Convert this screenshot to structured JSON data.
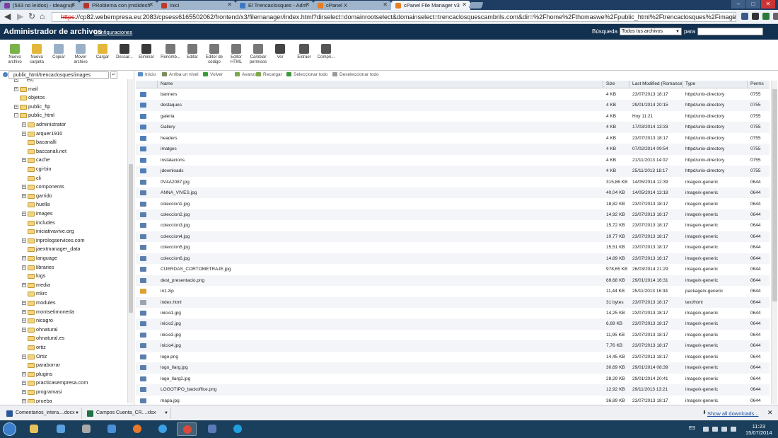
{
  "browser": {
    "tabs": [
      {
        "label": "(583 no leídos) - ideagrup",
        "color": "#7b3fa0"
      },
      {
        "label": "PRoblema con jmslidesh",
        "color": "#b5342e"
      },
      {
        "label": "Inici",
        "color": "#c0392b"
      },
      {
        "label": "El Trencaclosques - Adm",
        "color": "#3e78c2"
      },
      {
        "label": "cPanel X",
        "color": "#e67e22"
      },
      {
        "label": "cPanel File Manager v3",
        "color": "#e67e22"
      }
    ],
    "url_scheme": "https",
    "url_rest": "://cp82.webempresa.eu:2083/cpsess6165502062/frontend/x3/filemanager/index.html?dirselect=domainrootselect&domainselect=trencaclosquescambrils.com&dir=%2Fhome%2Fthomaswe%2Fpublic_html%2Ftrencaclosques%2Fimages"
  },
  "header": {
    "title": "Administrador de archivos",
    "config_link": "Configuraciones",
    "search_label": "Búsqueda",
    "search_scope": "Todos tus archivos",
    "search_for_label": "para",
    "search_value": ""
  },
  "toolbar": [
    {
      "label": "Nuevo archivo",
      "color": "#7ab34a"
    },
    {
      "label": "Nueva carpeta",
      "color": "#e3b83a"
    },
    {
      "label": "Copiar",
      "color": "#9ab0c8"
    },
    {
      "label": "Mover archivo",
      "color": "#9ab0c8"
    },
    {
      "label": "Cargar",
      "color": "#e3b83a"
    },
    {
      "label": "Descar...",
      "color": "#3a3a3a"
    },
    {
      "label": "Eliminar",
      "color": "#3a3a3a"
    },
    {
      "label": "Renomb...",
      "color": "#777777"
    },
    {
      "label": "Editar",
      "color": "#777777"
    },
    {
      "label": "Editor de código",
      "color": "#777777"
    },
    {
      "label": "Editor HTML",
      "color": "#777777"
    },
    {
      "label": "Cambiar permisos",
      "color": "#777777"
    },
    {
      "label": "Ver",
      "color": "#444444"
    },
    {
      "label": "Extraer",
      "color": "#555555"
    },
    {
      "label": "Compri...",
      "color": "#555555"
    }
  ],
  "left_panel": {
    "path": "public_html/trencaclosques/images",
    "tree": [
      {
        "label": "etc",
        "level": 1,
        "expander": "+",
        "folder": false
      },
      {
        "label": "mail",
        "level": 1,
        "expander": "+",
        "folder": true
      },
      {
        "label": "objetos",
        "level": 1,
        "expander": "",
        "folder": true
      },
      {
        "label": "public_ftp",
        "level": 1,
        "expander": "+",
        "folder": true
      },
      {
        "label": "public_html",
        "level": 1,
        "expander": "−",
        "folder": true
      },
      {
        "label": "administrator",
        "level": 2,
        "expander": "+",
        "folder": true
      },
      {
        "label": "arquer1910",
        "level": 2,
        "expander": "+",
        "folder": true
      },
      {
        "label": "bacanalli",
        "level": 2,
        "expander": "",
        "folder": true
      },
      {
        "label": "baccanali.net",
        "level": 2,
        "expander": "",
        "folder": true
      },
      {
        "label": "cache",
        "level": 2,
        "expander": "+",
        "folder": true
      },
      {
        "label": "cgi-bin",
        "level": 2,
        "expander": "",
        "folder": true
      },
      {
        "label": "cli",
        "level": 2,
        "expander": "",
        "folder": true
      },
      {
        "label": "components",
        "level": 2,
        "expander": "+",
        "folder": true
      },
      {
        "label": "garrido",
        "level": 2,
        "expander": "+",
        "folder": true
      },
      {
        "label": "huella",
        "level": 2,
        "expander": "",
        "folder": true
      },
      {
        "label": "images",
        "level": 2,
        "expander": "+",
        "folder": true
      },
      {
        "label": "includes",
        "level": 2,
        "expander": "",
        "folder": true
      },
      {
        "label": "iniciativavive.org",
        "level": 2,
        "expander": "",
        "folder": true
      },
      {
        "label": "inprologservices.com",
        "level": 2,
        "expander": "+",
        "folder": true
      },
      {
        "label": "jaextmanager_data",
        "level": 2,
        "expander": "",
        "folder": true
      },
      {
        "label": "language",
        "level": 2,
        "expander": "+",
        "folder": true
      },
      {
        "label": "libraries",
        "level": 2,
        "expander": "+",
        "folder": true
      },
      {
        "label": "logs",
        "level": 2,
        "expander": "",
        "folder": true
      },
      {
        "label": "media",
        "level": 2,
        "expander": "+",
        "folder": true
      },
      {
        "label": "mkrc",
        "level": 2,
        "expander": "",
        "folder": true
      },
      {
        "label": "modules",
        "level": 2,
        "expander": "+",
        "folder": true
      },
      {
        "label": "montsetimoneda",
        "level": 2,
        "expander": "+",
        "folder": true
      },
      {
        "label": "nicagro",
        "level": 2,
        "expander": "+",
        "folder": true
      },
      {
        "label": "ohnatural",
        "level": 2,
        "expander": "+",
        "folder": true
      },
      {
        "label": "ohnatural.es",
        "level": 2,
        "expander": "",
        "folder": true
      },
      {
        "label": "ortiz",
        "level": 2,
        "expander": "",
        "folder": true
      },
      {
        "label": "Ortiz",
        "level": 2,
        "expander": "+",
        "folder": true
      },
      {
        "label": "paraborrar",
        "level": 2,
        "expander": "",
        "folder": true
      },
      {
        "label": "plugins",
        "level": 2,
        "expander": "+",
        "folder": true
      },
      {
        "label": "practicasempresa.com",
        "level": 2,
        "expander": "+",
        "folder": true
      },
      {
        "label": "programasi",
        "level": 2,
        "expander": "+",
        "folder": true
      },
      {
        "label": "prueba",
        "level": 2,
        "expander": "+",
        "folder": true
      }
    ]
  },
  "actions": [
    {
      "label": "Inicio",
      "color": "#5b8dc9"
    },
    {
      "label": "Arriba un nivel",
      "color": "#7a8f5a"
    },
    {
      "label": "Volver",
      "color": "#3a9a3a"
    },
    {
      "label": "Avanzar",
      "color": "#7aa84a"
    },
    {
      "label": "Recargar",
      "color": "#7aa84a"
    },
    {
      "label": "Seleccionar todo",
      "color": "#3a9a3a"
    },
    {
      "label": "Deseleccionar todo",
      "color": "#9a9a9a"
    }
  ],
  "grid": {
    "columns": [
      "Name",
      "Size",
      "Last Modified (Romance",
      "Type",
      "Perms"
    ],
    "rows": [
      {
        "kind": "folder",
        "name": "banners",
        "size": "4 KB",
        "modified": "23/07/2013 18:17",
        "type": "httpd/unix-directory",
        "perms": "0755"
      },
      {
        "kind": "folder",
        "name": "destaques",
        "size": "4 KB",
        "modified": "29/01/2014 20:15",
        "type": "httpd/unix-directory",
        "perms": "0755"
      },
      {
        "kind": "folder",
        "name": "galeria",
        "size": "4 KB",
        "modified": "Hoy 11:21",
        "type": "httpd/unix-directory",
        "perms": "0755"
      },
      {
        "kind": "folder",
        "name": "Gallery",
        "size": "4 KB",
        "modified": "17/03/2014 13:33",
        "type": "httpd/unix-directory",
        "perms": "0755"
      },
      {
        "kind": "folder",
        "name": "headers",
        "size": "4 KB",
        "modified": "23/07/2013 18:17",
        "type": "httpd/unix-directory",
        "perms": "0755"
      },
      {
        "kind": "folder",
        "name": "imatges",
        "size": "4 KB",
        "modified": "07/02/2014 09:54",
        "type": "httpd/unix-directory",
        "perms": "0755"
      },
      {
        "kind": "folder",
        "name": "instalacions",
        "size": "4 KB",
        "modified": "21/11/2013 14:02",
        "type": "httpd/unix-directory",
        "perms": "0755"
      },
      {
        "kind": "folder",
        "name": "jdownloads",
        "size": "4 KB",
        "modified": "25/11/2013 18:17",
        "type": "httpd/unix-directory",
        "perms": "0755"
      },
      {
        "kind": "image",
        "name": "0V4A2087.jpg",
        "size": "315,86 KB",
        "modified": "14/05/2014 12:39",
        "type": "image/x-generic",
        "perms": "0644"
      },
      {
        "kind": "image",
        "name": "ANNA_VIVES.jpg",
        "size": "40,04 KB",
        "modified": "14/05/2014 13:18",
        "type": "image/x-generic",
        "perms": "0644"
      },
      {
        "kind": "image",
        "name": "coleccion1.jpg",
        "size": "18,82 KB",
        "modified": "23/07/2013 18:17",
        "type": "image/x-generic",
        "perms": "0644"
      },
      {
        "kind": "image",
        "name": "coleccion2.jpg",
        "size": "14,92 KB",
        "modified": "23/07/2013 18:17",
        "type": "image/x-generic",
        "perms": "0644"
      },
      {
        "kind": "image",
        "name": "coleccion3.jpg",
        "size": "15,72 KB",
        "modified": "23/07/2013 18:17",
        "type": "image/x-generic",
        "perms": "0644"
      },
      {
        "kind": "image",
        "name": "coleccion4.jpg",
        "size": "10,77 KB",
        "modified": "23/07/2013 18:17",
        "type": "image/x-generic",
        "perms": "0644"
      },
      {
        "kind": "image",
        "name": "coleccion5.jpg",
        "size": "15,51 KB",
        "modified": "23/07/2013 18:17",
        "type": "image/x-generic",
        "perms": "0644"
      },
      {
        "kind": "image",
        "name": "coleccion6.jpg",
        "size": "14,89 KB",
        "modified": "23/07/2013 18:17",
        "type": "image/x-generic",
        "perms": "0644"
      },
      {
        "kind": "image",
        "name": "CUERDAS_CORTOMETRAJE.jpg",
        "size": "978,65 KB",
        "modified": "26/03/2014 21:29",
        "type": "image/x-generic",
        "perms": "0644"
      },
      {
        "kind": "image",
        "name": "dest_presentacio.png",
        "size": "69,68 KB",
        "modified": "29/01/2014 16:31",
        "type": "image/x-generic",
        "perms": "0644"
      },
      {
        "kind": "zip",
        "name": "in1.zip",
        "size": "11,44 KB",
        "modified": "25/11/2013 16:34",
        "type": "package/x-generic",
        "perms": "0644"
      },
      {
        "kind": "html",
        "name": "index.html",
        "size": "31 bytes",
        "modified": "23/07/2013 18:17",
        "type": "text/html",
        "perms": "0644"
      },
      {
        "kind": "image",
        "name": "inicio1.jpg",
        "size": "14,25 KB",
        "modified": "23/07/2013 18:17",
        "type": "image/x-generic",
        "perms": "0644"
      },
      {
        "kind": "image",
        "name": "inicio2.jpg",
        "size": "6,69 KB",
        "modified": "23/07/2013 18:17",
        "type": "image/x-generic",
        "perms": "0644"
      },
      {
        "kind": "image",
        "name": "inicio3.jpg",
        "size": "11,95 KB",
        "modified": "23/07/2013 18:17",
        "type": "image/x-generic",
        "perms": "0644"
      },
      {
        "kind": "image",
        "name": "inicio4.jpg",
        "size": "7,76 KB",
        "modified": "23/07/2013 18:17",
        "type": "image/x-generic",
        "perms": "0644"
      },
      {
        "kind": "image",
        "name": "logo.png",
        "size": "14,45 KB",
        "modified": "23/07/2013 18:17",
        "type": "image/x-generic",
        "perms": "0644"
      },
      {
        "kind": "image",
        "name": "logo_llarg.jpg",
        "size": "30,69 KB",
        "modified": "29/01/2014 08:39",
        "type": "image/x-generic",
        "perms": "0644"
      },
      {
        "kind": "image",
        "name": "logo_llarg2.jpg",
        "size": "28,29 KB",
        "modified": "29/01/2014 20:41",
        "type": "image/x-generic",
        "perms": "0644"
      },
      {
        "kind": "image",
        "name": "LOGOTIPO_backoffice.png",
        "size": "12,92 KB",
        "modified": "29/11/2013 13:21",
        "type": "image/x-generic",
        "perms": "0644"
      },
      {
        "kind": "image",
        "name": "mapa.jpg",
        "size": "36,89 KB",
        "modified": "23/07/2013 18:17",
        "type": "image/x-generic",
        "perms": "0644"
      }
    ]
  },
  "downloads": {
    "items": [
      {
        "label": "Comentarios_intera....docx",
        "color": "#2b5797"
      },
      {
        "label": "Campos Cuenta_CR....xlsx",
        "color": "#1e7145"
      }
    ],
    "show_all": "Show all downloads..."
  },
  "taskbar": {
    "apps": [
      {
        "name": "explorer",
        "color": "#e8c15a"
      },
      {
        "name": "media",
        "color": "#5aa0e0"
      },
      {
        "name": "utility",
        "color": "#aaaaaa"
      },
      {
        "name": "mail",
        "color": "#4a8fd8"
      },
      {
        "name": "firefox",
        "color": "#e8782a"
      },
      {
        "name": "ie",
        "color": "#3aa0e8"
      },
      {
        "name": "chrome",
        "color": "#d94a3a"
      },
      {
        "name": "network",
        "color": "#5a7ab8"
      },
      {
        "name": "skype",
        "color": "#1fa0e0"
      }
    ],
    "lang": "ES",
    "time": "11:23",
    "date": "15/07/2014"
  }
}
